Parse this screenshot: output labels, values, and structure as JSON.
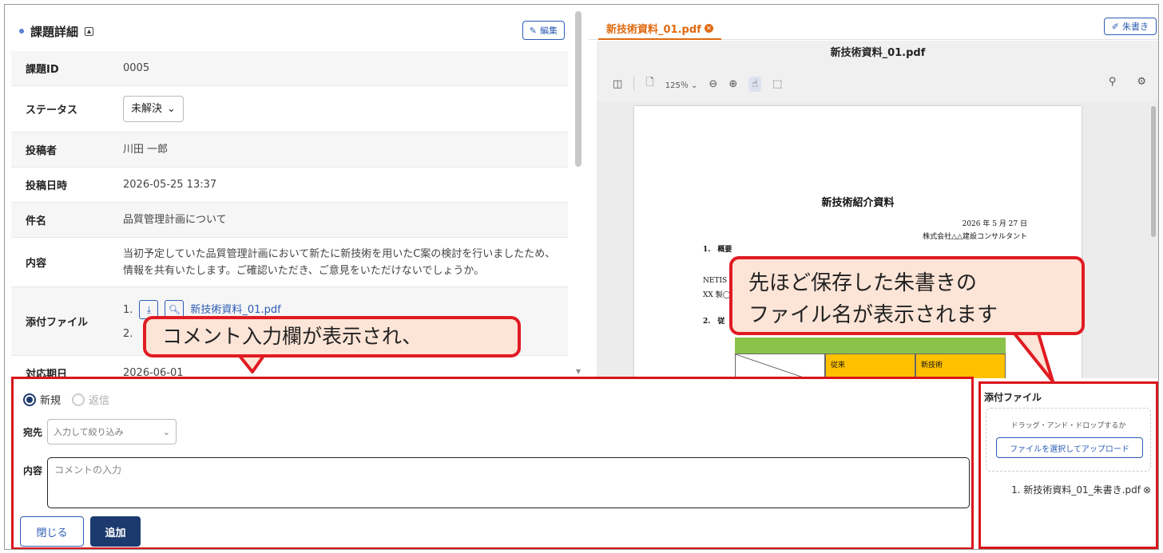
{
  "left_panel": {
    "title": "課題詳細",
    "edit_label": "編集",
    "fields": {
      "id": {
        "label": "課題ID",
        "value": "0005"
      },
      "status": {
        "label": "ステータス",
        "value": "未解決"
      },
      "author": {
        "label": "投稿者",
        "value": "川田 一郎"
      },
      "datetime": {
        "label": "投稿日時",
        "value": "2026-05-25 13:37"
      },
      "subject": {
        "label": "件名",
        "value": "品質管理計画について"
      },
      "content": {
        "label": "内容",
        "line1": "当初予定していた品質管理計画において新たに新技術を用いたC案の検討を行いましたため、",
        "line2": "情報を共有いたします。ご確認いただき、ご意見をいただけないでしょうか。"
      },
      "attachments": {
        "label": "添付ファイル",
        "item1_no": "1.",
        "item1_name": "新技術資料_01.pdf",
        "item2_no": "2."
      },
      "due": {
        "label": "対応期日",
        "value": "2026-06-01"
      }
    }
  },
  "pdf_viewer": {
    "tab_label": "新技術資料_01.pdf",
    "markup_label": "朱書き",
    "file_title": "新技術資料_01.pdf",
    "zoom": "125％",
    "document": {
      "title": "新技術紹介資料",
      "date": "2026 年 5 月 27 日",
      "company": "株式会社△△建設コンサルタント",
      "section1": "1.　概要",
      "para1a": "NETIS",
      "para1b": "XX 製◯",
      "section2": "2.　従",
      "table_col1": "従来",
      "table_col2": "新技術"
    }
  },
  "comment_form": {
    "radio_new": "新規",
    "radio_reply": "返信",
    "to_label": "宛先",
    "to_placeholder": "入力して絞り込み",
    "body_label": "内容",
    "body_placeholder": "コメントの入力",
    "close_label": "閉じる",
    "add_label": "追加"
  },
  "attachment_panel": {
    "title": "添付ファイル",
    "drop_text": "ドラッグ・アンド・ドロップするか",
    "upload_label": "ファイルを選択してアップロード",
    "file_item": "1. 新技術資料_01_朱書き.pdf"
  },
  "callouts": {
    "comment": "コメント入力欄が表示され、",
    "filename_line1": "先ほど保存した朱書きの",
    "filename_line2": "ファイル名が表示されます"
  },
  "colors": {
    "accent_blue": "#2b5cb5",
    "navy": "#1c3a6e",
    "tab_orange": "#e06a10",
    "highlight_red": "#d9141b",
    "callout_fill": "#fce4d6"
  }
}
